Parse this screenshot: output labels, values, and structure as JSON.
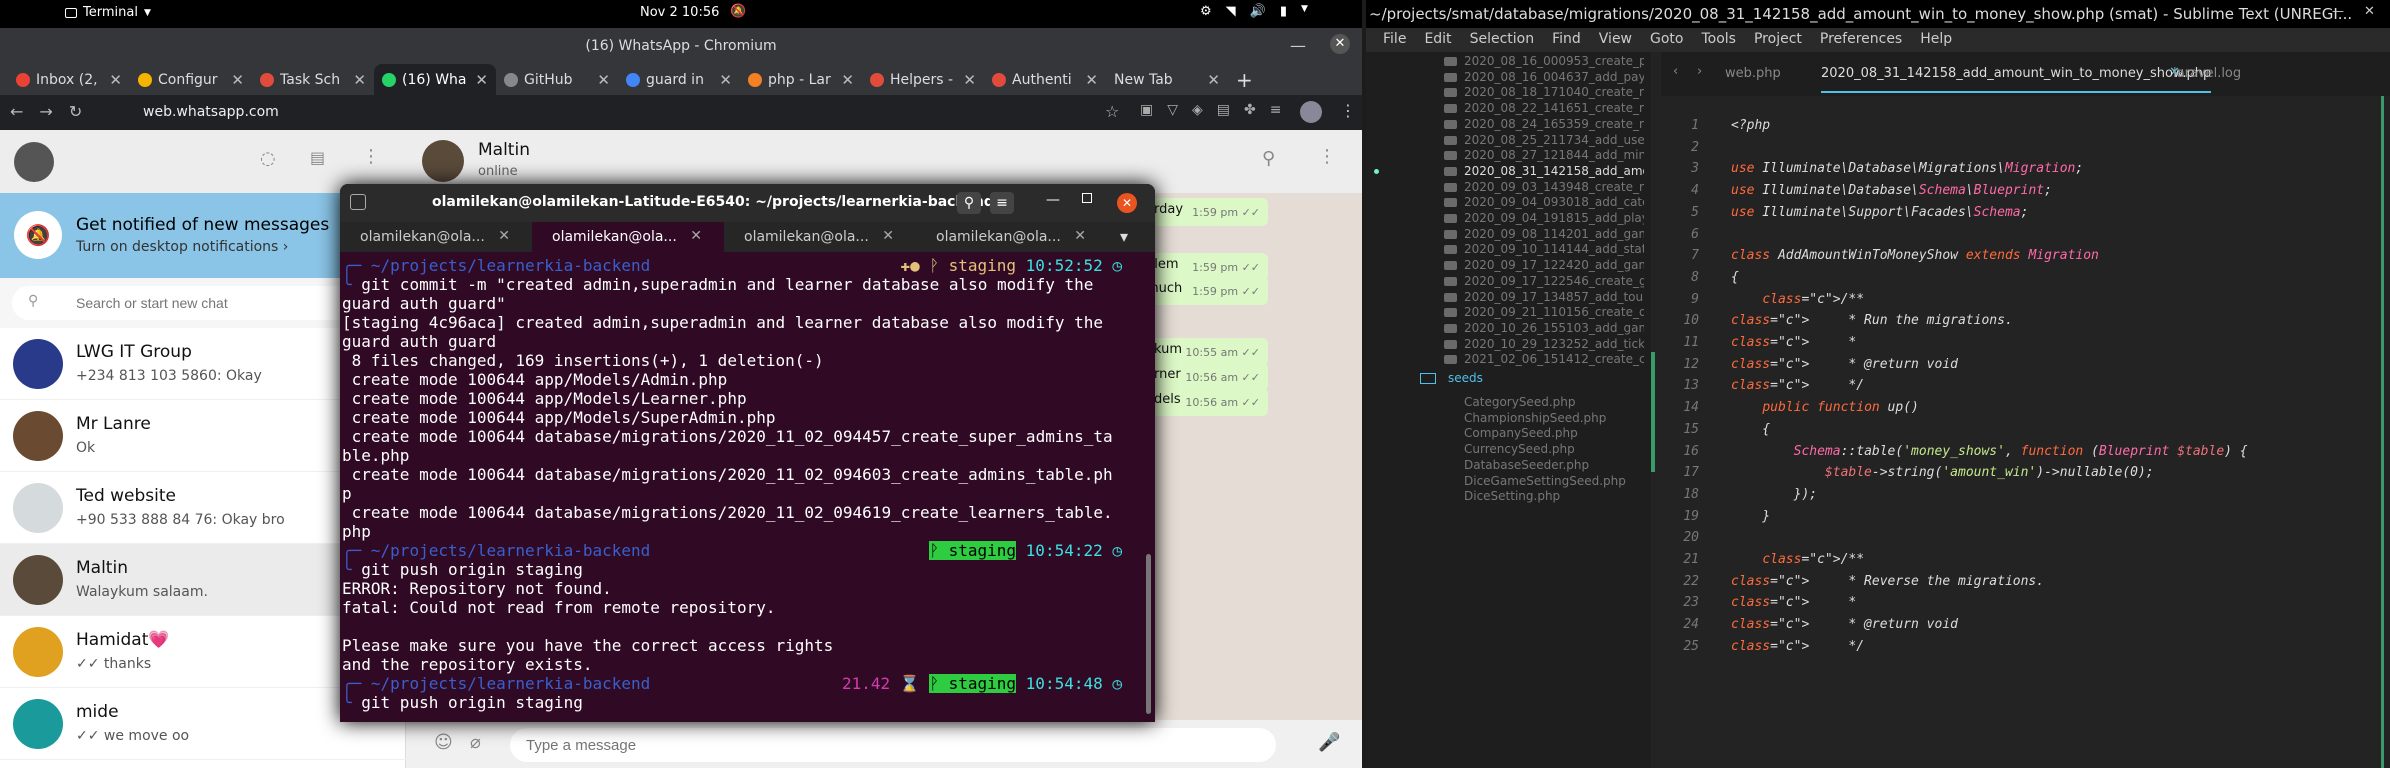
{
  "topbar": {
    "activity": "Terminal",
    "clock": "Nov 2  10:56"
  },
  "chrome": {
    "window_title": "(16) WhatsApp - Chromium",
    "tabs": [
      {
        "label": "Inbox (2,",
        "color": "#ea4335"
      },
      {
        "label": "Configur",
        "color": "#f4b400"
      },
      {
        "label": "Task Sch",
        "color": "#e04b3b"
      },
      {
        "label": "(16) Wha",
        "color": "#25d366",
        "active": true
      },
      {
        "label": "GitHub",
        "color": "#888888"
      },
      {
        "label": "guard in",
        "color": "#4285f4"
      },
      {
        "label": "php - Lar",
        "color": "#f48024"
      },
      {
        "label": "Helpers -",
        "color": "#e04b3b"
      },
      {
        "label": "Authenti",
        "color": "#e04b3b"
      },
      {
        "label": "New Tab",
        "color": ""
      }
    ],
    "url": "web.whatsapp.com"
  },
  "whatsapp": {
    "notify_title": "Get notified of new messages",
    "notify_sub": "Turn on desktop notifications ›",
    "search_placeholder": "Search or start new chat",
    "chats": [
      {
        "name": "LWG IT Group",
        "last": "+234 813 103 5860: Okay",
        "color": "#2a3a8a"
      },
      {
        "name": "Mr Lanre",
        "last": "Ok",
        "color": "#6b4a32"
      },
      {
        "name": "Ted website",
        "last": "+90 533 888 84 76: Okay bro",
        "color": "#d5dadd"
      },
      {
        "name": "Maltin",
        "last": "Walaykum salaam.",
        "color": "#5a4a3a",
        "selected": true
      },
      {
        "name": "Hamidat💗",
        "last": "✓✓ thanks",
        "color": "#e0a020"
      },
      {
        "name": "mide",
        "last": "✓✓ we move oo",
        "color": "#1a9a9a"
      }
    ],
    "conversation": {
      "name": "Maltin",
      "status": "online",
      "bubbles": [
        {
          "text": "erday",
          "time": "1:59 pm ✓✓"
        },
        {
          "text": "blem",
          "time": "1:59 pm ✓✓"
        },
        {
          "text": "much",
          "time": "1:59 pm ✓✓"
        },
        {
          "text": "ekum",
          "time": "10:55 am ✓✓"
        },
        {
          "text": "arner",
          "time": "10:56 am ✓✓"
        },
        {
          "text": "odels",
          "time": "10:56 am ✓✓"
        }
      ],
      "input_placeholder": "Type a message"
    }
  },
  "terminal": {
    "title": "olamilekan@olamilekan-Latitude-E6540: ~/projects/learnerkia-backend",
    "tabs": [
      "olamilekan@ola...",
      "olamilekan@ola...",
      "olamilekan@ola...",
      "olamilekan@ola..."
    ],
    "prompt_path": "~/projects/learnerkia-backend",
    "branch": "ᚹ staging",
    "lines": [
      {
        "kind": "prompt",
        "status": "✚●",
        "time": "10:52:52"
      },
      {
        "kind": "cmd",
        "text": " git commit -m \"created admin,superadmin and learner database also modify the"
      },
      {
        "kind": "out",
        "text": "guard auth guard\""
      },
      {
        "kind": "out",
        "text": "[staging 4c96aca] created admin,superadmin and learner database also modify the"
      },
      {
        "kind": "out",
        "text": "guard auth guard"
      },
      {
        "kind": "out",
        "text": " 8 files changed, 169 insertions(+), 1 deletion(-)"
      },
      {
        "kind": "out",
        "text": " create mode 100644 app/Models/Admin.php"
      },
      {
        "kind": "out",
        "text": " create mode 100644 app/Models/Learner.php"
      },
      {
        "kind": "out",
        "text": " create mode 100644 app/Models/SuperAdmin.php"
      },
      {
        "kind": "out",
        "text": " create mode 100644 database/migrations/2020_11_02_094457_create_super_admins_ta"
      },
      {
        "kind": "out",
        "text": "ble.php"
      },
      {
        "kind": "out",
        "text": " create mode 100644 database/migrations/2020_11_02_094603_create_admins_table.ph"
      },
      {
        "kind": "out",
        "text": "p"
      },
      {
        "kind": "out",
        "text": " create mode 100644 database/migrations/2020_11_02_094619_create_learners_table."
      },
      {
        "kind": "out",
        "text": "php"
      },
      {
        "kind": "prompt",
        "status": "",
        "time": "10:54:22"
      },
      {
        "kind": "cmd",
        "text": " git push origin staging"
      },
      {
        "kind": "out",
        "text": "ERROR: Repository not found."
      },
      {
        "kind": "out",
        "text": "fatal: Could not read from remote repository."
      },
      {
        "kind": "out",
        "text": ""
      },
      {
        "kind": "out",
        "text": "Please make sure you have the correct access rights"
      },
      {
        "kind": "out",
        "text": "and the repository exists."
      },
      {
        "kind": "prompt",
        "status": "21.42 ⌛",
        "time": "10:54:48"
      },
      {
        "kind": "cmd",
        "text": " git push origin staging"
      }
    ]
  },
  "sublime": {
    "title": "~/projects/smat/database/migrations/2020_08_31_142158_add_amount_win_to_money_show.php (smat) - Sublime Text (UNREGI...",
    "menu": [
      "File",
      "Edit",
      "Selection",
      "Find",
      "View",
      "Goto",
      "Tools",
      "Project",
      "Preferences",
      "Help"
    ],
    "files": [
      "2020_08_16_000953_create_plat",
      "2020_08_16_004637_add_paym",
      "2020_08_18_171040_create_mo",
      "2020_08_22_141651_create_mo",
      "2020_08_24_165359_create_mo",
      "2020_08_25_211734_add_user_",
      "2020_08_27_121844_add_minut",
      "2020_08_31_142158_add_amou",
      "2020_09_03_143948_create_mo",
      "2020_09_04_093018_add_categ",
      "2020_09_04_191815_add_playin",
      "2020_09_08_114201_add_game",
      "2020_09_10_114144_add_status",
      "2020_09_17_122420_add_game",
      "2020_09_17_122546_create_gan",
      "2020_09_17_134857_add_tourn",
      "2020_09_21_110156_create_dice",
      "2020_10_26_155103_add_game",
      "2020_10_29_123252_add_ticket_",
      "2021_02_06_151412_create_cate"
    ],
    "active_file_index": 7,
    "folder": "seeds",
    "seed_files": [
      "CategorySeed.php",
      "ChampionshipSeed.php",
      "CompanySeed.php",
      "CurrencySeed.php",
      "DatabaseSeeder.php",
      "DiceGameSettingSeed.php",
      "DiceSetting.php"
    ],
    "editor_tabs": [
      "web.php",
      "2020_08_31_142158_add_amount_win_to_money_show.php",
      "laravel.log"
    ],
    "code": [
      "<?php",
      "",
      "use Illuminate\\Database\\Migrations\\Migration;",
      "use Illuminate\\Database\\Schema\\Blueprint;",
      "use Illuminate\\Support\\Facades\\Schema;",
      "",
      "class AddAmountWinToMoneyShow extends Migration",
      "{",
      "    /**",
      "     * Run the migrations.",
      "     *",
      "     * @return void",
      "     */",
      "    public function up()",
      "    {",
      "        Schema::table('money_shows', function (Blueprint $table) {",
      "            $table->string('amount_win')->nullable(0);",
      "        });",
      "    }",
      "",
      "    /**",
      "     * Reverse the migrations.",
      "     *",
      "     * @return void",
      "     */"
    ]
  }
}
